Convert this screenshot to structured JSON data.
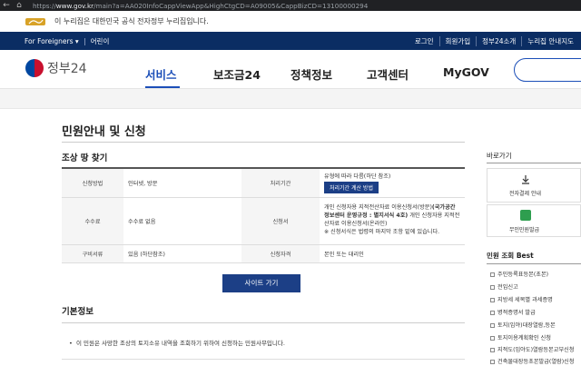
{
  "browser": {
    "url_prefix": "https://",
    "url_host": "www.gov.kr",
    "url_rest": "/main?a=AA020InfoCappViewApp&HighCtgCD=A09005&CappBizCD=13100000294"
  },
  "gov_notice": "이 누리집은 대한민국 공식 전자정부 누리집입니다.",
  "topnav": {
    "for_foreigners": "For Foreigners",
    "kids": "어린이",
    "login": "로그인",
    "signup": "회원가입",
    "about": "정부24소개",
    "sitemap": "누리집 안내지도"
  },
  "header": {
    "logo_text": "정부24",
    "menu": [
      "서비스",
      "보조금24",
      "정책정보",
      "고객센터",
      "MyGOV"
    ]
  },
  "page": {
    "title": "민원안내 및 신청",
    "section1": "조상 땅 찾기",
    "table": {
      "apply_method_label": "신청방법",
      "apply_method_value": "인터넷, 방문",
      "period_label": "처리기간",
      "period_value": "유형에 따라 다름(하단 참조)",
      "period_btn": "처리기간 계산 방법",
      "fee_label": "수수료",
      "fee_value": "수수료 없음",
      "docs_label": "신청서",
      "docs_line1a": "개인 신청자용 지적전산자료 이용신청서(방문)",
      "docs_line1b": "(국가공간정보센터 운영규정 : 별지서식 4호)",
      "docs_line1c": " 개인 신청자용 지적전산자료 이용신청서(온라인)",
      "docs_line2": "※ 신청서식은 법령의 마지막 조항 밑에 있습니다.",
      "evidence_label": "구비서류",
      "evidence_value": "있음 (하단참조)",
      "qual_label": "신청자격",
      "qual_value": "본인 또는 대리인"
    },
    "site_button": "사이트 가기",
    "section2": "기본정보",
    "basic_info": "이 민원은 사망한 조상의 토지소유 내역을 조회하기 위하여 신청하는 민원사무입니다."
  },
  "sidebar": {
    "title": "바로가기",
    "payment": "전자결제 안내",
    "unmanned": "무인민원발급",
    "best_title": "민원 조회 Best",
    "best_items": [
      "주민등록표등본(초본)",
      "전입신고",
      "지방세 세목별 과세증명",
      "병적증명서 발급",
      "토지(임야)대장열람,등본",
      "토지이용계획확인 신청",
      "지적도(임야도)열람등본교부신청",
      "건축물대장등초본발급(열람)신청"
    ]
  }
}
